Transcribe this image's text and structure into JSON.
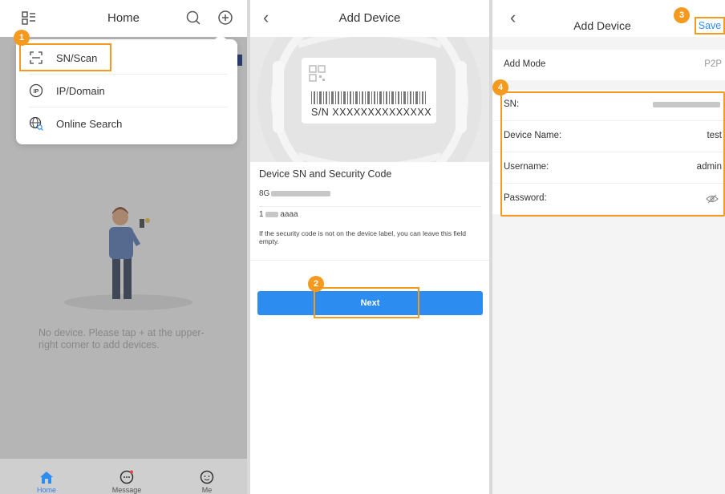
{
  "panel1": {
    "title": "Home",
    "menu": [
      {
        "label": "SN/Scan",
        "icon": "scan-icon"
      },
      {
        "label": "IP/Domain",
        "icon": "ip-icon"
      },
      {
        "label": "Online Search",
        "icon": "globe-search-icon"
      }
    ],
    "empty_message": "No device. Please tap + at the upper-right corner to add devices.",
    "tabs": [
      {
        "label": "Home",
        "icon": "home-icon",
        "active": true
      },
      {
        "label": "Message",
        "icon": "message-icon",
        "active": false
      },
      {
        "label": "Me",
        "icon": "me-icon",
        "active": false
      }
    ]
  },
  "panel2": {
    "title": "Add Device",
    "label_sn": "S/N  XXXXXXXXXXXXXX",
    "section_title": "Device SN and Security Code",
    "sn_prefix": "8G",
    "code_prefix": "1",
    "code_suffix": "aaaa",
    "hint": "If the security code is not on the device label, you can leave this field empty.",
    "next_label": "Next"
  },
  "panel3": {
    "title": "Add Device",
    "save_label": "Save",
    "add_mode_label": "Add Mode",
    "add_mode_value": "P2P",
    "sn_label": "SN:",
    "device_name_label": "Device Name:",
    "device_name_value": "test",
    "username_label": "Username:",
    "username_value": "admin",
    "password_label": "Password:"
  },
  "callouts": [
    "1",
    "2",
    "3",
    "4"
  ],
  "colors": {
    "accent": "#2d8cf0",
    "highlight": "#f39a1f"
  }
}
